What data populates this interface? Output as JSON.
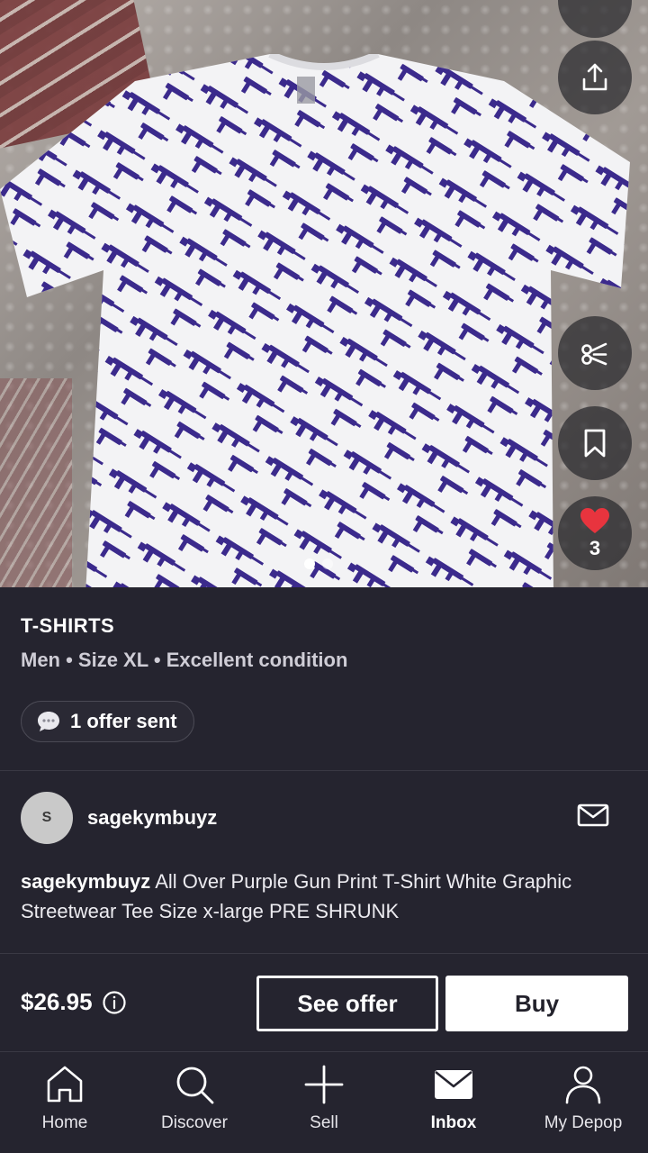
{
  "listing": {
    "category": "T-SHIRTS",
    "meta": "Men • Size XL • Excellent condition",
    "offer_pill": "1 offer sent",
    "likes": "3",
    "image_count": 2,
    "image_index": 1
  },
  "seller": {
    "avatar_initial": "S",
    "username": "sagekymbuyz"
  },
  "description": {
    "username": "sagekymbuyz",
    "text": " All Over Purple Gun Print T-Shirt White Graphic Streetwear Tee Size x-large PRE SHRUNK"
  },
  "purchase": {
    "price": "$26.95",
    "see_offer_label": "See offer",
    "buy_label": "Buy"
  },
  "tabs": [
    {
      "label": "Home",
      "icon": "home-icon"
    },
    {
      "label": "Discover",
      "icon": "search-icon"
    },
    {
      "label": "Sell",
      "icon": "plus-icon"
    },
    {
      "label": "Inbox",
      "icon": "mail-icon",
      "active": true
    },
    {
      "label": "My Depop",
      "icon": "person-icon"
    }
  ],
  "colors": {
    "background": "#25242f",
    "like_heart": "#e8343e",
    "print_purple": "#3b2a8c"
  }
}
